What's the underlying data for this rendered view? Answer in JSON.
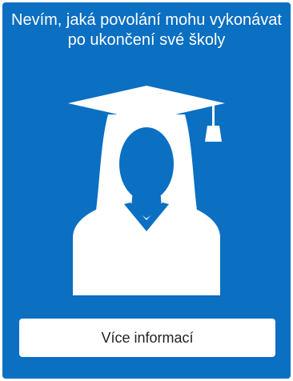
{
  "card": {
    "title": "Nevím, jaká povolání mohu vykonávat po ukončení své školy",
    "button_label": "Více informací",
    "illustration_icon": "graduate-woman-icon",
    "background_color": "#0b6fc2",
    "foreground_color": "#ffffff"
  }
}
